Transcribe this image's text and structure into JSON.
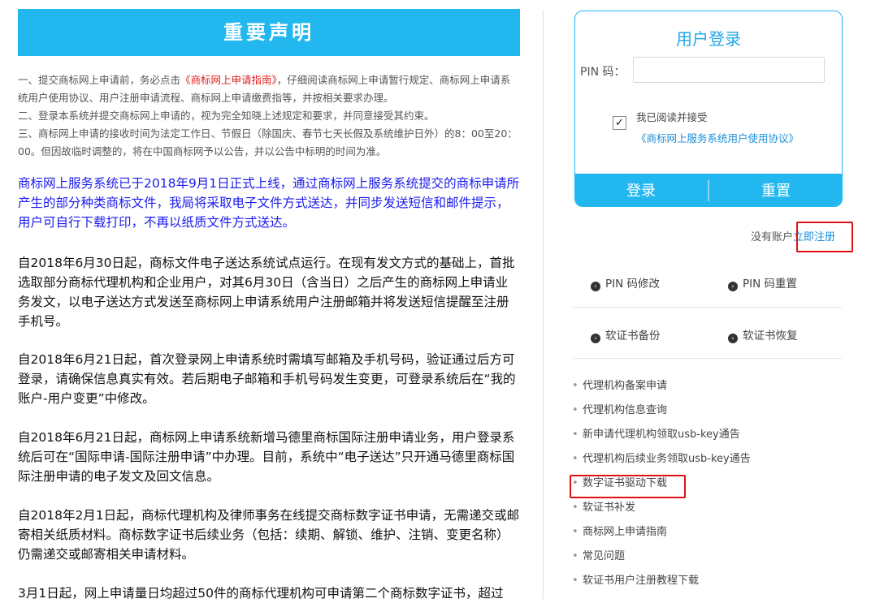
{
  "left": {
    "banner_title": "重要声明",
    "notices": [
      {
        "before": "一、提交商标网上申请前，务必点击",
        "link": "《商标网上申请指南》",
        "after": "，仔细阅读商标网上申请暂行规定、商标网上申请系统用户使用协议、用户注册申请流程、商标网上申请缴费指等，并按相关要求办理。"
      },
      {
        "text": "二、登录本系统并提交商标网上申请的，视为完全知晓上述规定和要求，并同意接受其约束。"
      },
      {
        "text": "三、商标网上申请的接收时间为法定工作日、节假日（除国庆、春节七天长假及系统维护日外）的8：00至20：00。但因故临时调整的，将在中国商标网予以公告，并以公告中标明的时间为准。"
      }
    ],
    "paragraphs": [
      "商标网上服务系统已于2018年9月1日正式上线，通过商标网上服务系统提交的商标申请所产生的部分种类商标文件，我局将采取电子文件方式送达，并同步发送短信和邮件提示，用户可自行下载打印，不再以纸质文件方式送达。",
      "自2018年6月30日起，商标文件电子送达系统试点运行。在现有发文方式的基础上，首批选取部分商标代理机构和企业用户，对其6月30日（含当日）之后产生的商标网上申请业务发文，以电子送达方式发送至商标网上申请系统用户注册邮箱并将发送短信提醒至注册手机号。",
      "自2018年6月21日起，首次登录网上申请系统时需填写邮箱及手机号码，验证通过后方可登录，请确保信息真实有效。若后期电子邮箱和手机号码发生变更，可登录系统后在“我的账户-用户变更”中修改。",
      "自2018年6月21日起，商标网上申请系统新增马德里商标国际注册申请业务，用户登录系统后可在“国际申请-国际注册申请”中办理。目前，系统中“电子送达”只开通马德里商标国际注册申请的电子发文及回文信息。",
      "自2018年2月1日起，商标代理机构及律师事务在线提交商标数字证书申请，无需递交或邮寄相关纸质材料。商标数字证书后续业务（包括：续期、解锁、维护、注销、变更名称）仍需递交或邮寄相关申请材料。",
      "3月1日起，网上申请量日均超过50件的商标代理机构可申请第二个商标数字证书，超过"
    ]
  },
  "login": {
    "title": "用户登录",
    "pin_label": "PIN 码：",
    "pin_value": "",
    "agree_checked": "✓",
    "agree_text": "我已阅读并接受",
    "agree_link": "《商标网上服务系统用户使用协议》",
    "login_button": "登录",
    "reset_button": "重置"
  },
  "register": {
    "prompt": "没有账户",
    "link": "立即注册"
  },
  "tools": [
    {
      "label": "PIN 码修改",
      "icon": "chevron-right-circle-icon"
    },
    {
      "label": "PIN 码重置",
      "icon": "chevron-right-circle-icon"
    },
    {
      "label": "软证书备份",
      "icon": "chevron-right-circle-icon"
    },
    {
      "label": "软证书恢复",
      "icon": "chevron-right-circle-icon"
    }
  ],
  "links": [
    "代理机构备案申请",
    "代理机构信息查询",
    "新申请代理机构领取usb-key通告",
    "代理机构后续业务领取usb-key通告",
    "数字证书驱动下载",
    "软证书补发",
    "商标网上申请指南",
    "常见问题",
    "软证书用户注册教程下载"
  ],
  "colors": {
    "accent": "#22b8ef",
    "link_blue": "#1a8ed8",
    "notice_red": "#e02020",
    "highlight_box": "#e01010",
    "blue_paragraph": "#1a1aee"
  }
}
